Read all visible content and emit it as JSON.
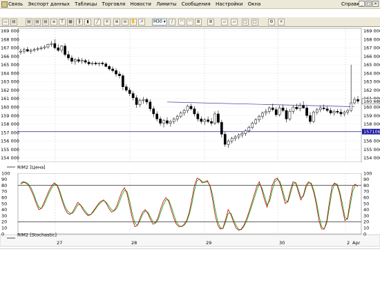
{
  "menu": {
    "items": [
      "Связь",
      "Экспорт данных",
      "Таблицы",
      "Торговля",
      "Новости",
      "Лимиты",
      "Сообщения",
      "Настройки",
      "Окна"
    ],
    "help": "Справка"
  },
  "toolbar": {
    "timeframe": "M30",
    "icons": [
      "window-icon",
      "chart-icon",
      "chart-icon",
      "chart-icon",
      "chart-icon",
      "document-icon",
      "text-icon",
      "grid-icon",
      "bar-chart-icon",
      "candle-icon",
      "line-icon",
      "crosshair-icon",
      "zoom-in-icon",
      "zoom-out-icon",
      "hand-icon",
      "arrow-icon",
      "line-draw-icon",
      "arc-icon",
      "arc-icon",
      "fib-icon",
      "fib-icon",
      "channel-icon",
      "channel-icon",
      "box-icon",
      "box-icon",
      "settings-icon",
      "close-icon"
    ]
  },
  "colors": {
    "background": "#ffffff",
    "grid": "#d0d0d0",
    "candle_up": "#ffffff",
    "candle_down": "#000000",
    "trendline": "#3a3a9a",
    "level_line": "#1a1aa0",
    "stoch_k": "#c00000",
    "stoch_d": "#00a000",
    "price_label_bg": "#1a1aa0",
    "stoch_level": "#000000"
  },
  "chart_data": [
    {
      "type": "candlestick",
      "title": "",
      "legend": "RIM2 [Цена]",
      "y_ticks": [
        "169 000",
        "168 000",
        "167 000",
        "166 000",
        "165 000",
        "164 000",
        "163 000",
        "162 000",
        "161 000",
        "160 000",
        "159 000",
        "158 000",
        "157 000",
        "156 000",
        "155 000",
        "154 000"
      ],
      "ylim": [
        153500,
        169300
      ],
      "current_price": "160 680",
      "level_price": "157106",
      "level_value": 157106,
      "trendline": {
        "start": {
          "index": 43,
          "price": 160600
        },
        "end": {
          "index": 98,
          "price": 160050
        }
      },
      "candles": [
        {
          "o": 166500,
          "h": 166900,
          "l": 166200,
          "c": 166600
        },
        {
          "o": 166600,
          "h": 167000,
          "l": 166300,
          "c": 166800
        },
        {
          "o": 166800,
          "h": 167100,
          "l": 166500,
          "c": 166600
        },
        {
          "o": 166600,
          "h": 166900,
          "l": 166300,
          "c": 166700
        },
        {
          "o": 166700,
          "h": 167000,
          "l": 166500,
          "c": 166800
        },
        {
          "o": 166800,
          "h": 167100,
          "l": 166600,
          "c": 166900
        },
        {
          "o": 166900,
          "h": 167200,
          "l": 166700,
          "c": 167000
        },
        {
          "o": 167000,
          "h": 167300,
          "l": 166800,
          "c": 167100
        },
        {
          "o": 167100,
          "h": 167500,
          "l": 166900,
          "c": 167400
        },
        {
          "o": 167400,
          "h": 167800,
          "l": 167100,
          "c": 167500
        },
        {
          "o": 167500,
          "h": 168000,
          "l": 166800,
          "c": 167000
        },
        {
          "o": 167000,
          "h": 167400,
          "l": 166500,
          "c": 166700
        },
        {
          "o": 166700,
          "h": 167300,
          "l": 166400,
          "c": 167200
        },
        {
          "o": 167200,
          "h": 167500,
          "l": 166000,
          "c": 166200
        },
        {
          "o": 166200,
          "h": 166600,
          "l": 165500,
          "c": 165800
        },
        {
          "o": 165800,
          "h": 166100,
          "l": 165100,
          "c": 165400
        },
        {
          "o": 165400,
          "h": 165800,
          "l": 165000,
          "c": 165600
        },
        {
          "o": 165600,
          "h": 165900,
          "l": 165200,
          "c": 165400
        },
        {
          "o": 165400,
          "h": 165800,
          "l": 165100,
          "c": 165500
        },
        {
          "o": 165500,
          "h": 165700,
          "l": 165100,
          "c": 165300
        },
        {
          "o": 165300,
          "h": 165600,
          "l": 164900,
          "c": 165100
        },
        {
          "o": 165100,
          "h": 165400,
          "l": 164900,
          "c": 165200
        },
        {
          "o": 165200,
          "h": 165400,
          "l": 164900,
          "c": 165100
        },
        {
          "o": 165100,
          "h": 165300,
          "l": 164800,
          "c": 165200
        },
        {
          "o": 165200,
          "h": 165400,
          "l": 164900,
          "c": 165100
        },
        {
          "o": 165100,
          "h": 165300,
          "l": 164700,
          "c": 164800
        },
        {
          "o": 164800,
          "h": 165000,
          "l": 164300,
          "c": 164500
        },
        {
          "o": 164500,
          "h": 164800,
          "l": 164100,
          "c": 164300
        },
        {
          "o": 164300,
          "h": 164600,
          "l": 163600,
          "c": 163900
        },
        {
          "o": 163900,
          "h": 164200,
          "l": 163400,
          "c": 163700
        },
        {
          "o": 163700,
          "h": 163900,
          "l": 162000,
          "c": 162400
        },
        {
          "o": 162400,
          "h": 162700,
          "l": 161800,
          "c": 162000
        },
        {
          "o": 162000,
          "h": 162300,
          "l": 161300,
          "c": 161600
        },
        {
          "o": 161600,
          "h": 161900,
          "l": 160800,
          "c": 161100
        },
        {
          "o": 161100,
          "h": 161400,
          "l": 159900,
          "c": 160300
        },
        {
          "o": 160300,
          "h": 161000,
          "l": 160000,
          "c": 160800
        },
        {
          "o": 160800,
          "h": 161200,
          "l": 160400,
          "c": 160900
        },
        {
          "o": 160900,
          "h": 161100,
          "l": 160300,
          "c": 160600
        },
        {
          "o": 160600,
          "h": 160900,
          "l": 159500,
          "c": 159800
        },
        {
          "o": 159800,
          "h": 160100,
          "l": 158800,
          "c": 159200
        },
        {
          "o": 159200,
          "h": 159500,
          "l": 158300,
          "c": 158600
        },
        {
          "o": 158600,
          "h": 158900,
          "l": 157800,
          "c": 158100
        },
        {
          "o": 158100,
          "h": 158600,
          "l": 157600,
          "c": 158400
        },
        {
          "o": 158400,
          "h": 158800,
          "l": 157900,
          "c": 158100
        },
        {
          "o": 158100,
          "h": 158500,
          "l": 157700,
          "c": 158300
        },
        {
          "o": 158300,
          "h": 158800,
          "l": 158000,
          "c": 158600
        },
        {
          "o": 158600,
          "h": 159100,
          "l": 158300,
          "c": 158900
        },
        {
          "o": 158900,
          "h": 159500,
          "l": 158700,
          "c": 159300
        },
        {
          "o": 159300,
          "h": 159800,
          "l": 159000,
          "c": 159600
        },
        {
          "o": 159600,
          "h": 160300,
          "l": 159300,
          "c": 160100
        },
        {
          "o": 160100,
          "h": 160400,
          "l": 159600,
          "c": 159800
        },
        {
          "o": 159800,
          "h": 160100,
          "l": 158900,
          "c": 159200
        },
        {
          "o": 159200,
          "h": 159500,
          "l": 158300,
          "c": 158600
        },
        {
          "o": 158600,
          "h": 158900,
          "l": 158000,
          "c": 158300
        },
        {
          "o": 158300,
          "h": 158700,
          "l": 157900,
          "c": 158500
        },
        {
          "o": 158500,
          "h": 158900,
          "l": 158100,
          "c": 158300
        },
        {
          "o": 158300,
          "h": 158700,
          "l": 157800,
          "c": 158100
        },
        {
          "o": 158100,
          "h": 159500,
          "l": 157900,
          "c": 159200
        },
        {
          "o": 159200,
          "h": 159600,
          "l": 158000,
          "c": 158200
        },
        {
          "o": 158200,
          "h": 158500,
          "l": 156400,
          "c": 156800
        },
        {
          "o": 156800,
          "h": 157100,
          "l": 155300,
          "c": 155600
        },
        {
          "o": 155600,
          "h": 156200,
          "l": 155200,
          "c": 156000
        },
        {
          "o": 156000,
          "h": 156500,
          "l": 155700,
          "c": 156300
        },
        {
          "o": 156300,
          "h": 156700,
          "l": 156000,
          "c": 156500
        },
        {
          "o": 156500,
          "h": 156900,
          "l": 156200,
          "c": 156700
        },
        {
          "o": 156700,
          "h": 157100,
          "l": 156400,
          "c": 156900
        },
        {
          "o": 156900,
          "h": 157400,
          "l": 156600,
          "c": 157200
        },
        {
          "o": 157200,
          "h": 157800,
          "l": 157000,
          "c": 157600
        },
        {
          "o": 157600,
          "h": 158300,
          "l": 157400,
          "c": 158100
        },
        {
          "o": 158100,
          "h": 158700,
          "l": 157900,
          "c": 158500
        },
        {
          "o": 158500,
          "h": 159100,
          "l": 158200,
          "c": 158900
        },
        {
          "o": 158900,
          "h": 159500,
          "l": 158600,
          "c": 159300
        },
        {
          "o": 159300,
          "h": 159800,
          "l": 159000,
          "c": 159500
        },
        {
          "o": 159500,
          "h": 160100,
          "l": 159200,
          "c": 159900
        },
        {
          "o": 159900,
          "h": 160400,
          "l": 159500,
          "c": 159700
        },
        {
          "o": 159700,
          "h": 160000,
          "l": 158900,
          "c": 159100
        },
        {
          "o": 159100,
          "h": 160200,
          "l": 158900,
          "c": 159900
        },
        {
          "o": 159900,
          "h": 160300,
          "l": 159400,
          "c": 159600
        },
        {
          "o": 159600,
          "h": 159900,
          "l": 158200,
          "c": 158600
        },
        {
          "o": 158600,
          "h": 159800,
          "l": 158400,
          "c": 159500
        },
        {
          "o": 159500,
          "h": 160200,
          "l": 159200,
          "c": 160000
        },
        {
          "o": 160000,
          "h": 160400,
          "l": 159600,
          "c": 159800
        },
        {
          "o": 159800,
          "h": 160500,
          "l": 159500,
          "c": 160200
        },
        {
          "o": 160200,
          "h": 160700,
          "l": 159800,
          "c": 159900
        },
        {
          "o": 159900,
          "h": 160200,
          "l": 158700,
          "c": 159000
        },
        {
          "o": 159000,
          "h": 159400,
          "l": 158000,
          "c": 158300
        },
        {
          "o": 158300,
          "h": 159600,
          "l": 158100,
          "c": 159400
        },
        {
          "o": 159400,
          "h": 159900,
          "l": 159100,
          "c": 159700
        },
        {
          "o": 159700,
          "h": 160200,
          "l": 159400,
          "c": 159900
        },
        {
          "o": 159900,
          "h": 160300,
          "l": 159600,
          "c": 159800
        },
        {
          "o": 159800,
          "h": 160100,
          "l": 159400,
          "c": 159600
        },
        {
          "o": 159600,
          "h": 159900,
          "l": 159100,
          "c": 159300
        },
        {
          "o": 159300,
          "h": 159700,
          "l": 159000,
          "c": 159500
        },
        {
          "o": 159500,
          "h": 159800,
          "l": 159200,
          "c": 159400
        },
        {
          "o": 159400,
          "h": 159800,
          "l": 158900,
          "c": 159200
        },
        {
          "o": 159200,
          "h": 159600,
          "l": 158900,
          "c": 159400
        },
        {
          "o": 159400,
          "h": 159800,
          "l": 159100,
          "c": 159600
        },
        {
          "o": 159600,
          "h": 165000,
          "l": 159400,
          "c": 160500
        },
        {
          "o": 160500,
          "h": 161200,
          "l": 160300,
          "c": 160900
        },
        {
          "o": 160900,
          "h": 161300,
          "l": 160400,
          "c": 160700
        }
      ]
    },
    {
      "type": "line",
      "title": "",
      "legend": "RIM2 [Stochastic]",
      "y_ticks": [
        "100",
        "90",
        "80",
        "70",
        "60",
        "50",
        "40",
        "30",
        "20",
        "10",
        "0"
      ],
      "ylim": [
        0,
        100
      ],
      "levels": [
        80,
        20
      ],
      "series": [
        {
          "values": [
            82,
            85,
            84,
            80,
            72,
            62,
            50,
            40,
            42,
            52,
            62,
            72,
            80,
            84,
            80,
            68,
            54,
            42,
            34,
            32,
            36,
            44,
            52,
            48,
            40,
            34,
            30,
            32,
            38,
            44,
            50,
            54,
            56,
            50,
            42,
            36,
            38,
            46,
            58,
            70,
            76,
            66,
            46,
            26,
            12,
            14,
            26,
            36,
            40,
            34,
            24,
            16,
            18,
            28,
            42,
            54,
            60,
            54,
            40,
            26,
            16,
            12,
            12,
            16,
            22,
            36,
            58,
            80,
            92,
            90,
            84,
            86,
            88,
            78,
            56,
            30,
            14,
            8,
            10,
            24,
            40,
            32,
            20,
            10,
            6,
            8,
            14,
            24,
            36,
            50,
            64,
            78,
            86,
            72,
            56,
            44,
            60,
            80,
            90,
            92,
            82,
            66,
            50,
            54,
            72,
            86,
            84,
            70,
            56,
            64,
            80,
            86,
            82,
            68,
            48,
            22,
            8,
            8,
            22,
            52,
            78,
            84,
            80,
            66,
            42,
            22,
            26,
            54,
            78,
            82,
            78
          ]
        },
        {
          "values": [
            84,
            86,
            85,
            82,
            76,
            66,
            54,
            44,
            42,
            48,
            58,
            68,
            76,
            82,
            81,
            72,
            58,
            46,
            38,
            34,
            34,
            40,
            48,
            48,
            43,
            37,
            32,
            32,
            36,
            42,
            48,
            52,
            55,
            52,
            46,
            40,
            38,
            42,
            52,
            64,
            72,
            70,
            54,
            34,
            18,
            14,
            22,
            32,
            38,
            36,
            28,
            20,
            18,
            24,
            36,
            48,
            56,
            56,
            46,
            32,
            20,
            14,
            12,
            14,
            20,
            32,
            50,
            72,
            88,
            90,
            86,
            85,
            86,
            80,
            64,
            40,
            20,
            10,
            9,
            20,
            34,
            34,
            24,
            14,
            8,
            7,
            12,
            20,
            32,
            45,
            58,
            72,
            82,
            76,
            62,
            48,
            54,
            72,
            86,
            90,
            86,
            72,
            56,
            52,
            66,
            82,
            85,
            74,
            60,
            62,
            76,
            84,
            84,
            72,
            54,
            30,
            12,
            8,
            18,
            44,
            70,
            82,
            82,
            70,
            50,
            28,
            24,
            46,
            70,
            80,
            80
          ]
        }
      ]
    }
  ],
  "x_axis": {
    "labels": [
      "27",
      "28",
      "29",
      "30",
      "2"
    ],
    "month_label": "Apr"
  }
}
